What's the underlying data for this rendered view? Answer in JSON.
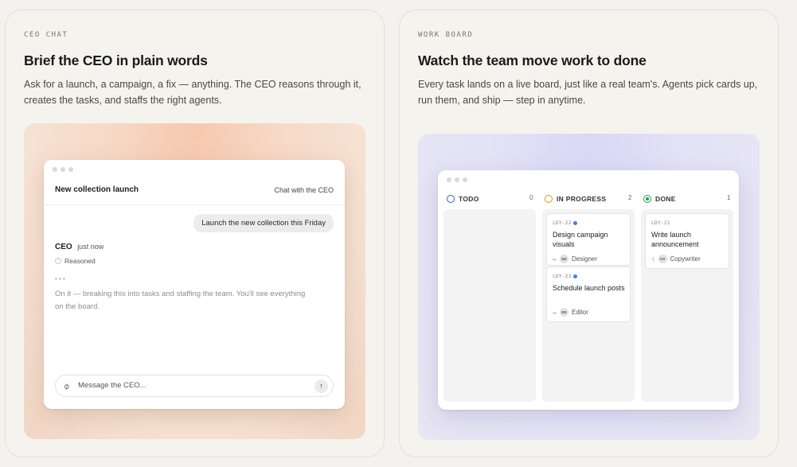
{
  "left_card": {
    "eyebrow": "CEO CHAT",
    "title": "Brief the CEO in plain words",
    "description": "Ask for a launch, a campaign, a fix — anything. The CEO reasons through it, creates the tasks, and staffs the right agents.",
    "chat": {
      "title": "New collection launch",
      "subtitle": "Chat with the CEO",
      "user_message": "Launch the new collection this Friday",
      "ceo_name": "CEO",
      "ceo_time": "just now",
      "reasoned_label": "Reasoned",
      "ceo_reply": "On it — breaking this into tasks and staffing the team. You'll see everything on the board.",
      "input_placeholder": "Message the CEO...",
      "icons": {
        "attach": "paperclip-icon",
        "send": "arrow-up-icon"
      }
    }
  },
  "right_card": {
    "eyebrow": "WORK BOARD",
    "title": "Watch the team move work to done",
    "description": "Every task lands on a live board, just like a real team's. Agents pick cards up, run them, and ship — step in anytime.",
    "board": {
      "columns": [
        {
          "name": "TODO",
          "count": "0",
          "color": "#3a5bd9"
        },
        {
          "name": "IN PROGRESS",
          "count": "2",
          "color": "#d99a2a"
        },
        {
          "name": "DONE",
          "count": "1",
          "color": "#2f9a57"
        }
      ],
      "tasks": {
        "in_progress": [
          {
            "id": "LDY-22",
            "title": "Design campaign visuals",
            "priority": "–",
            "avatar": "DE",
            "assignee": "Designer"
          },
          {
            "id": "LDY-23",
            "title": "Schedule launch posts",
            "priority": "–",
            "avatar": "ED",
            "assignee": "Editor"
          }
        ],
        "done": [
          {
            "id": "LDY-21",
            "title": "Write launch announcement",
            "priority": "↑",
            "avatar": "CO",
            "assignee": "Copywriter"
          }
        ]
      }
    }
  }
}
